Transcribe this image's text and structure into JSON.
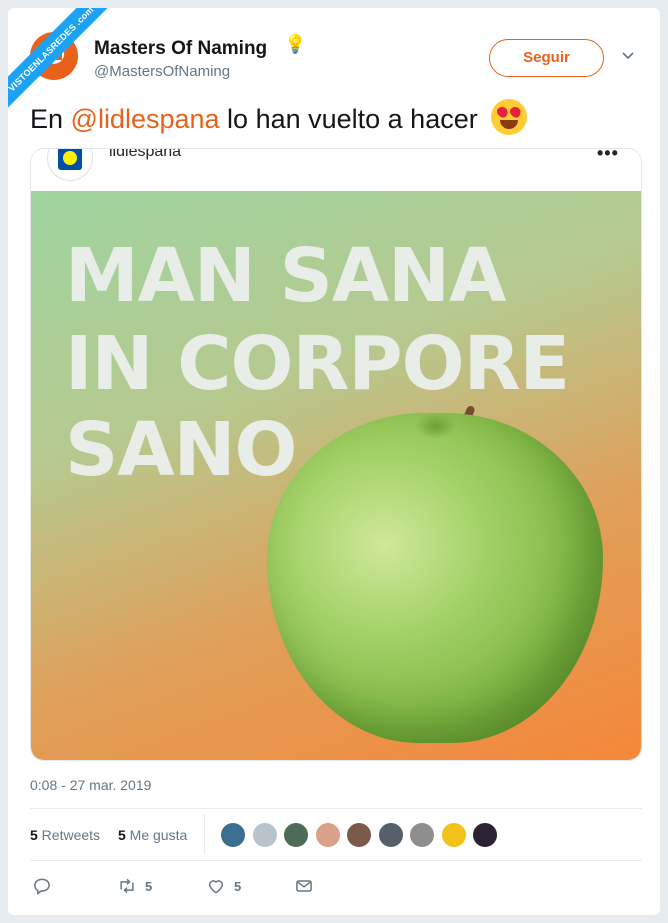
{
  "watermark": "VISTOENLASREDES .com",
  "author": {
    "name": "Masters Of Naming",
    "name_emoji_icon": "light-bulb-icon",
    "handle": "@MastersOfNaming"
  },
  "follow_button": "Seguir",
  "tweet": {
    "text_before": "En ",
    "mention": "@lidlespana",
    "text_after": " lo han vuelto a hacer",
    "emoji_icon": "heart-eyes-emoji-icon"
  },
  "embedded_post": {
    "username": "lidlespana",
    "more": "•••",
    "ad_lines": [
      "MAN SANA",
      "IN CORPORE",
      "SANO"
    ]
  },
  "timestamp": "0:08 - 27 mar. 2019",
  "stats": {
    "retweets_count": "5",
    "retweets_label": " Retweets",
    "likes_count": "5",
    "likes_label": " Me gusta"
  },
  "liker_avatars": [
    "#3b6e8f",
    "#b9c3cc",
    "#4e6b58",
    "#d9a08a",
    "#7a5a4a",
    "#55606b",
    "#8e8e8e",
    "#f2c21b",
    "#2b2233"
  ],
  "actions": {
    "reply_count": "",
    "retweet_count": "5",
    "like_count": "5"
  },
  "colors": {
    "accent": "#e8621c",
    "secondary_text": "#657786"
  }
}
